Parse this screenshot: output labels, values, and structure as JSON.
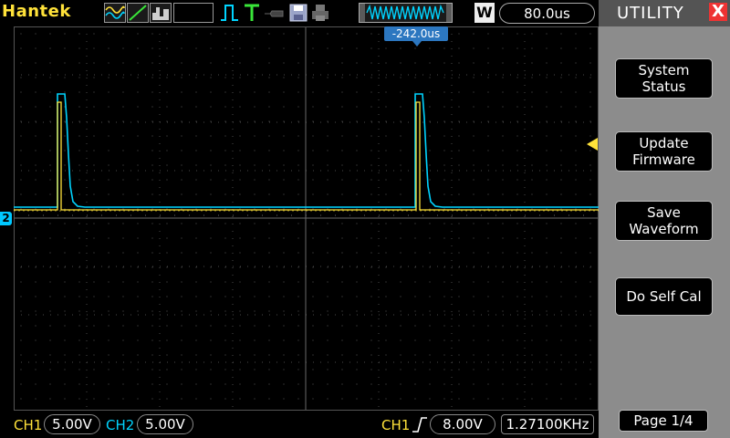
{
  "brand": "Hantek",
  "colors": {
    "ch1": "#ffe23a",
    "ch2": "#00d4ff",
    "panel": "#8c8c8c",
    "grid": "#5a5a5a"
  },
  "toolbar": {
    "icons": [
      "waveform-mode-icon",
      "slope-icon",
      "acquire-icon",
      "pulse-icon",
      "trigger-t-icon",
      "probe-icon",
      "save-disk-icon",
      "print-icon",
      "memory-waveform-icon"
    ],
    "w_badge": "W",
    "timebase": "80.0us"
  },
  "trigger_position": "-242.0us",
  "channel_marker": "2",
  "menu": {
    "title": "UTILITY",
    "close": "X",
    "items": [
      {
        "line1": "System",
        "line2": "Status"
      },
      {
        "line1": "Update",
        "line2": "Firmware"
      },
      {
        "line1": "Save",
        "line2": "Waveform"
      },
      {
        "line1": "Do Self Cal",
        "line2": ""
      }
    ],
    "page": "Page 1/4"
  },
  "bottom": {
    "ch1_label": "CH1",
    "ch1_scale": "5.00V",
    "ch2_label": "CH2",
    "ch2_scale": "5.00V",
    "trig_source": "CH1",
    "trig_level": "8.00V",
    "frequency": "1.27100KHz"
  }
}
